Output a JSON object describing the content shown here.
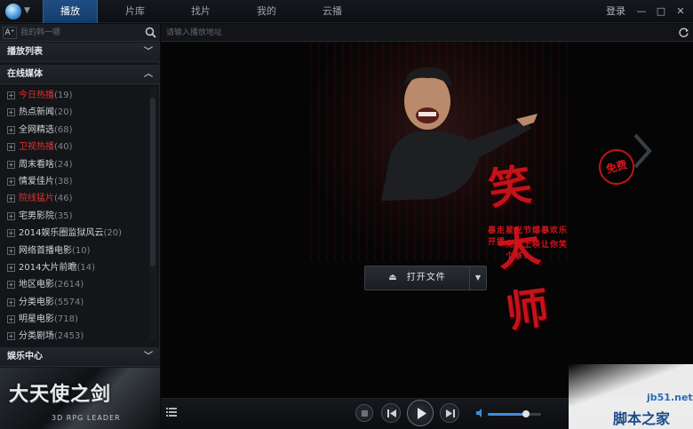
{
  "titlebar": {
    "tabs": [
      {
        "label": "播放",
        "active": true
      },
      {
        "label": "片库",
        "active": false
      },
      {
        "label": "找片",
        "active": false
      },
      {
        "label": "我的",
        "active": false
      },
      {
        "label": "云播",
        "active": false
      }
    ],
    "login": "登录",
    "min": "—",
    "max": "□",
    "close": "✕"
  },
  "sidebar": {
    "font_btn": "A⁺",
    "search_placeholder": "我的韩一哪",
    "sections": {
      "playlist": "播放列表",
      "online": "在线媒体",
      "entertainment": "娱乐中心"
    },
    "items": [
      {
        "label": "今日热播",
        "count": "(19)",
        "red": true
      },
      {
        "label": "热点新闻",
        "count": "(20)",
        "red": false
      },
      {
        "label": "全网精选",
        "count": "(68)",
        "red": false
      },
      {
        "label": "卫视热播",
        "count": "(40)",
        "red": true
      },
      {
        "label": "周末看啥",
        "count": "(24)",
        "red": false
      },
      {
        "label": "情爱佳片",
        "count": "(38)",
        "red": false
      },
      {
        "label": "院线猛片",
        "count": "(46)",
        "red": true
      },
      {
        "label": "宅男影院",
        "count": "(35)",
        "red": false
      },
      {
        "label": "2014娱乐圈监狱风云",
        "count": "(20)",
        "red": false
      },
      {
        "label": "网络首播电影",
        "count": "(10)",
        "red": false
      },
      {
        "label": "2014大片前瞻",
        "count": "(14)",
        "red": false
      },
      {
        "label": "地区电影",
        "count": "(2614)",
        "red": false
      },
      {
        "label": "分类电影",
        "count": "(5574)",
        "red": false
      },
      {
        "label": "明星电影",
        "count": "(718)",
        "red": false
      },
      {
        "label": "分类剧场",
        "count": "(2453)",
        "red": false
      }
    ],
    "banner": {
      "title": "大天使之剑",
      "subtitle": "3D RPG LEADER"
    }
  },
  "main": {
    "url_placeholder": "请输入播放地址",
    "poster": {
      "title": "笑大师",
      "badge": "免费",
      "line1": "暴走星光节爆暴欢乐开播",
      "line2": "免费上映让你笑个够!"
    },
    "open_file": "打开文件"
  },
  "controls": {
    "volume": 0.72
  },
  "watermark": {
    "site": "jb51.net",
    "name": "脚本之家"
  },
  "colors": {
    "accent": "#1e4e86",
    "highlight_red": "#e3322f",
    "volume_blue": "#3e8ede"
  }
}
